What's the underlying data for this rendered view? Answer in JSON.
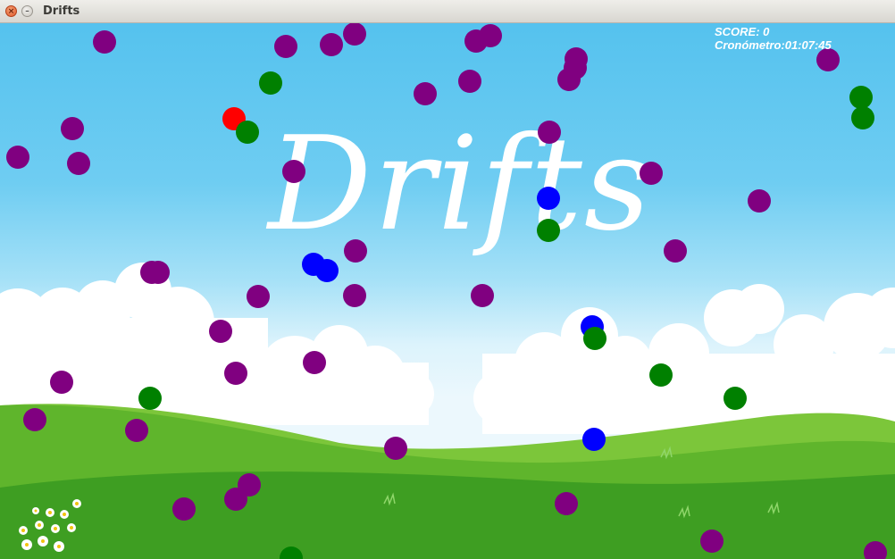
{
  "window": {
    "title": "Drifts",
    "close_glyph": "×",
    "min_glyph": "–"
  },
  "game": {
    "logo_text": "Drifts",
    "hud": {
      "score_text": "SCORE: 0",
      "timer_text": "Cronómetro:01:07:45"
    },
    "colors": {
      "purple": "#800080",
      "green": "#008000",
      "blue": "#0000ff",
      "red": "#ff0000"
    }
  }
}
